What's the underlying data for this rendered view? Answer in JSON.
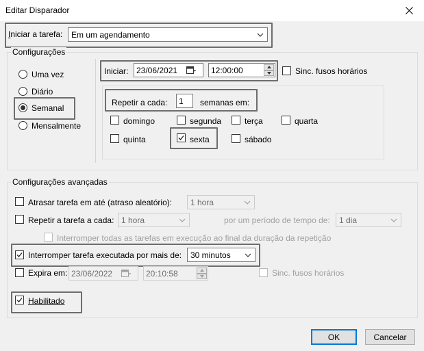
{
  "window": {
    "title": "Editar Disparador",
    "close_icon": "close-icon"
  },
  "start_task": {
    "label": "Iniciar a tarefa:",
    "value": "Em um agendamento"
  },
  "settings": {
    "legend": "Configurações",
    "schedule_options": [
      {
        "label": "Uma vez",
        "selected": false
      },
      {
        "label": "Diário",
        "selected": false
      },
      {
        "label": "Semanal",
        "selected": true
      },
      {
        "label": "Mensalmente",
        "selected": false
      }
    ],
    "start_label": "Iniciar:",
    "start_date": "23/06/2021",
    "start_time": "12:00:00",
    "sync_timezones_label": "Sinc. fusos horários",
    "sync_timezones_checked": false,
    "repeat_label": "Repetir a cada:",
    "repeat_value": "1",
    "repeat_unit_label": "semanas em:",
    "days": [
      {
        "label": "domingo",
        "checked": false
      },
      {
        "label": "segunda",
        "checked": false
      },
      {
        "label": "terça",
        "checked": false
      },
      {
        "label": "quarta",
        "checked": false
      },
      {
        "label": "quinta",
        "checked": false
      },
      {
        "label": "sexta",
        "checked": true
      },
      {
        "label": "sábado",
        "checked": false
      }
    ]
  },
  "advanced": {
    "legend": "Configurações avançadas",
    "delay_label": "Atrasar tarefa em até (atraso aleatório):",
    "delay_value": "1 hora",
    "repeat_task_label": "Repetir a tarefa a cada:",
    "repeat_task_value": "1 hora",
    "duration_label": "por um período de tempo de:",
    "duration_value": "1 dia",
    "stop_all_label": "Interromper todas as tarefas em execução ao final da duração da repetição",
    "stop_longer_label": "Interromper tarefa executada por mais de:",
    "stop_longer_value": "30 minutos",
    "stop_longer_checked": true,
    "expire_label": "Expira em:",
    "expire_date": "23/06/2022",
    "expire_time": "20:10:58",
    "expire_sync_label": "Sinc. fusos horários",
    "enabled_label": "Habilitado",
    "enabled_checked": true
  },
  "buttons": {
    "ok": "OK",
    "cancel": "Cancelar"
  }
}
